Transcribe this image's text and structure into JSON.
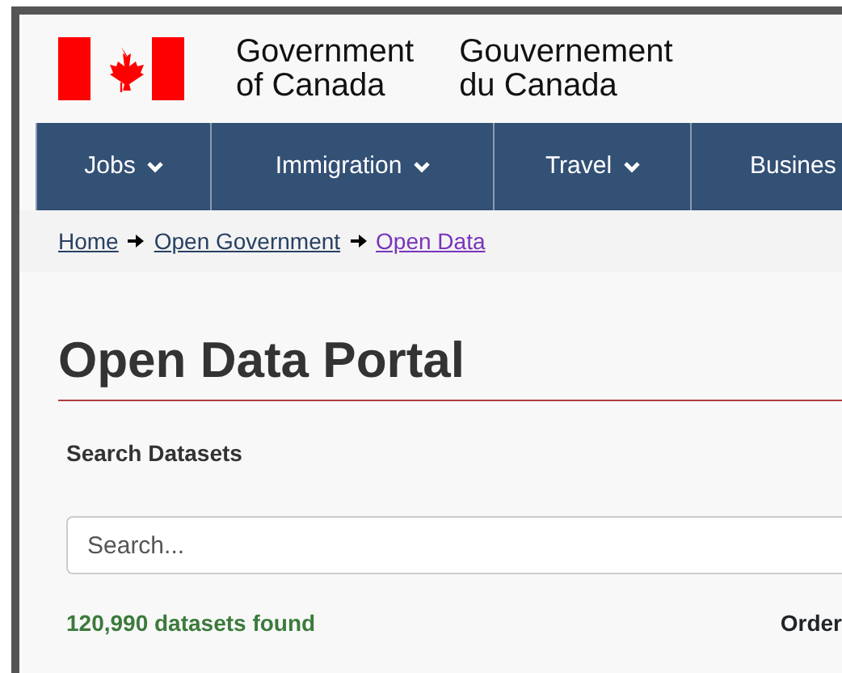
{
  "header": {
    "wordmark_en": [
      "Government",
      "of Canada"
    ],
    "wordmark_fr": [
      "Gouvernement",
      "du Canada"
    ]
  },
  "nav": [
    {
      "label": "Jobs",
      "dropdown": true
    },
    {
      "label": "Immigration",
      "dropdown": true
    },
    {
      "label": "Travel",
      "dropdown": true
    },
    {
      "label": "Busines",
      "dropdown": false
    }
  ],
  "breadcrumb": [
    {
      "label": "Home",
      "visited": false
    },
    {
      "label": "Open Government",
      "visited": false
    },
    {
      "label": "Open Data",
      "visited": true
    }
  ],
  "title": "Open Data Portal",
  "search": {
    "label": "Search Datasets",
    "placeholder": "Search..."
  },
  "results": {
    "count": "120,990 datasets found",
    "order_label": "Order"
  }
}
